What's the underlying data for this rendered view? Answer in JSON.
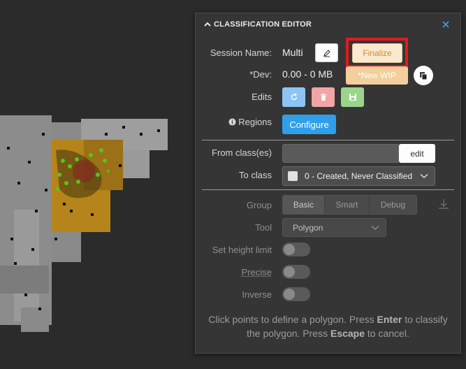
{
  "panel": {
    "title": "CLASSIFICATION EDITOR",
    "session_name_label": "Session Name:",
    "session_name_value": "Multi",
    "finalize_label": "Finalize",
    "dev_label": "*Dev:",
    "dev_value": "0.00 - 0 MB",
    "new_wip_label": "*New WIP",
    "edits_label": "Edits",
    "regions_label": "Regions",
    "configure_label": "Configure",
    "from_class_label": "From class(es)",
    "edit_label": "edit",
    "to_class_label": "To class",
    "to_class_value": "0 - Created, Never Classified",
    "group_label": "Group",
    "group_options": [
      "Basic",
      "Smart",
      "Debug"
    ],
    "group_selected": "Basic",
    "tool_label": "Tool",
    "tool_value": "Polygon",
    "set_height_label": "Set height limit",
    "precise_label": "Precise",
    "inverse_label": "Inverse",
    "set_height_on": false,
    "precise_on": false,
    "inverse_on": false,
    "help": {
      "part1": "Click points to define a polygon. Press ",
      "key1": "Enter",
      "part2": " to classify the polygon. Press ",
      "key2": "Escape",
      "part3": " to cancel."
    }
  },
  "colors": {
    "primary": "#2f9fea",
    "finalize_text": "#d08a2f",
    "highlight": "#e41a1a",
    "orange_tile": "#b5841a"
  }
}
